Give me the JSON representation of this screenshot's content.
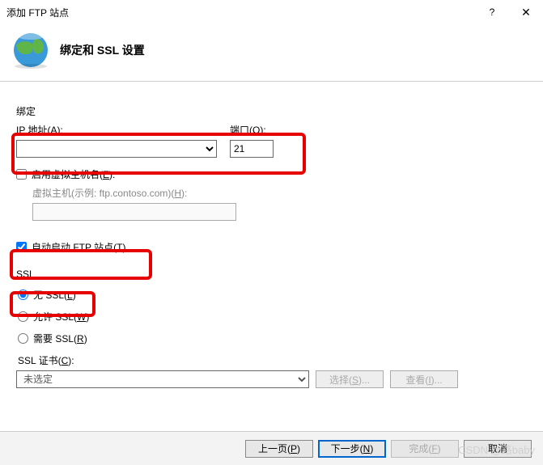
{
  "window": {
    "title": "添加 FTP 站点",
    "help": "?",
    "close": "✕"
  },
  "header": {
    "title": "绑定和 SSL 设置"
  },
  "binding": {
    "group_label": "绑定",
    "ip_label": "IP 地址(A):",
    "ip_value": "",
    "port_label": "端口(O):",
    "port_value": "21",
    "enable_vhost_label": "启用虚拟主机名(E):",
    "enable_vhost_checked": false,
    "vhost_label": "虚拟主机(示例: ftp.contoso.com)(H):",
    "vhost_value": ""
  },
  "auto_start": {
    "label": "自动启动 FTP 站点(T)",
    "checked": true
  },
  "ssl": {
    "group_label": "SSL",
    "no_ssl_label": "无 SSL(L)",
    "allow_ssl_label": "允许 SSL(W)",
    "require_ssl_label": "需要 SSL(R)",
    "selected": "none",
    "cert_label": "SSL 证书(C):",
    "cert_value": "未选定",
    "select_btn": "选择(S)...",
    "view_btn": "查看(I)..."
  },
  "footer": {
    "prev": "上一页(P)",
    "next": "下一步(N)",
    "finish": "完成(F)",
    "cancel": "取消"
  },
  "watermark": "CSDN @路baby"
}
